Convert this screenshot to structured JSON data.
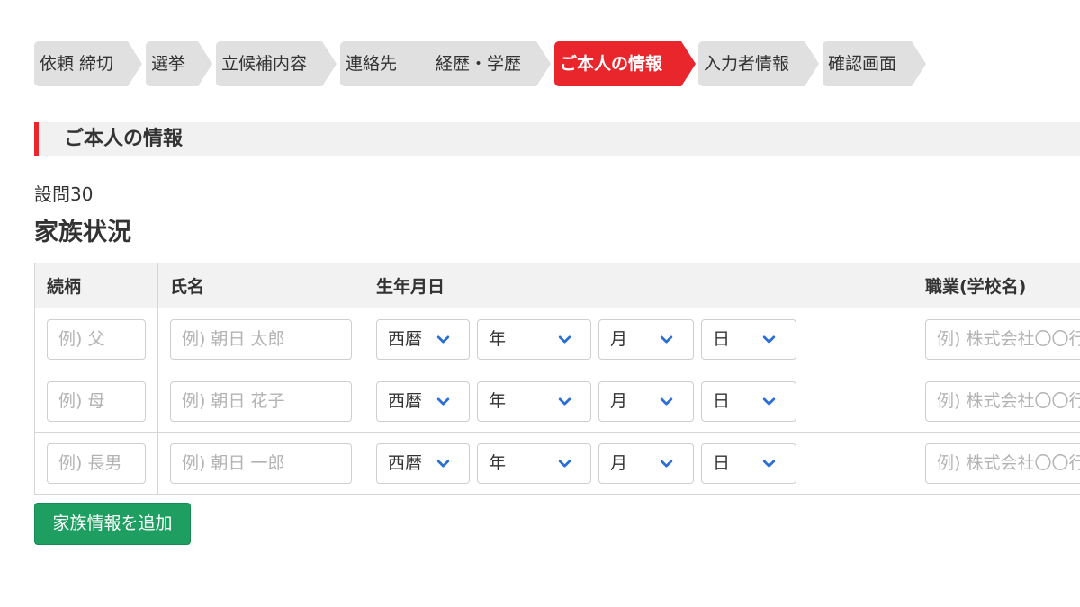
{
  "steps": [
    {
      "label": "依頼 締切"
    },
    {
      "label": "選挙"
    },
    {
      "label": "立候補内容"
    },
    {
      "label": "連絡先"
    },
    {
      "label": "経歴・学歴"
    },
    {
      "label": "ご本人の情報",
      "active": true
    },
    {
      "label": "入力者情報"
    },
    {
      "label": "確認画面"
    }
  ],
  "section": {
    "title": "ご本人の情報"
  },
  "question": {
    "number": "設問30",
    "title": "家族状況"
  },
  "table": {
    "headers": {
      "relation": "続柄",
      "name": "氏名",
      "birthdate": "生年月日",
      "occupation": "職業(学校名)"
    },
    "rows": [
      {
        "relation_placeholder": "例) 父",
        "name_placeholder": "例) 朝日 太郎",
        "era": "西暦",
        "year": "年",
        "month": "月",
        "day": "日",
        "occupation_placeholder": "例) 株式会社〇〇行"
      },
      {
        "relation_placeholder": "例) 母",
        "name_placeholder": "例) 朝日 花子",
        "era": "西暦",
        "year": "年",
        "month": "月",
        "day": "日",
        "occupation_placeholder": "例) 株式会社〇〇行"
      },
      {
        "relation_placeholder": "例) 長男",
        "name_placeholder": "例) 朝日 一郎",
        "era": "西暦",
        "year": "年",
        "month": "月",
        "day": "日",
        "occupation_placeholder": "例) 株式会社〇〇行"
      }
    ]
  },
  "add_button": {
    "label": "家族情報を追加"
  },
  "colors": {
    "accent": "#e8262c",
    "step_inactive": "#e0e0e0",
    "button_green": "#1e9e61",
    "chevron_blue": "#2b6fd6"
  }
}
